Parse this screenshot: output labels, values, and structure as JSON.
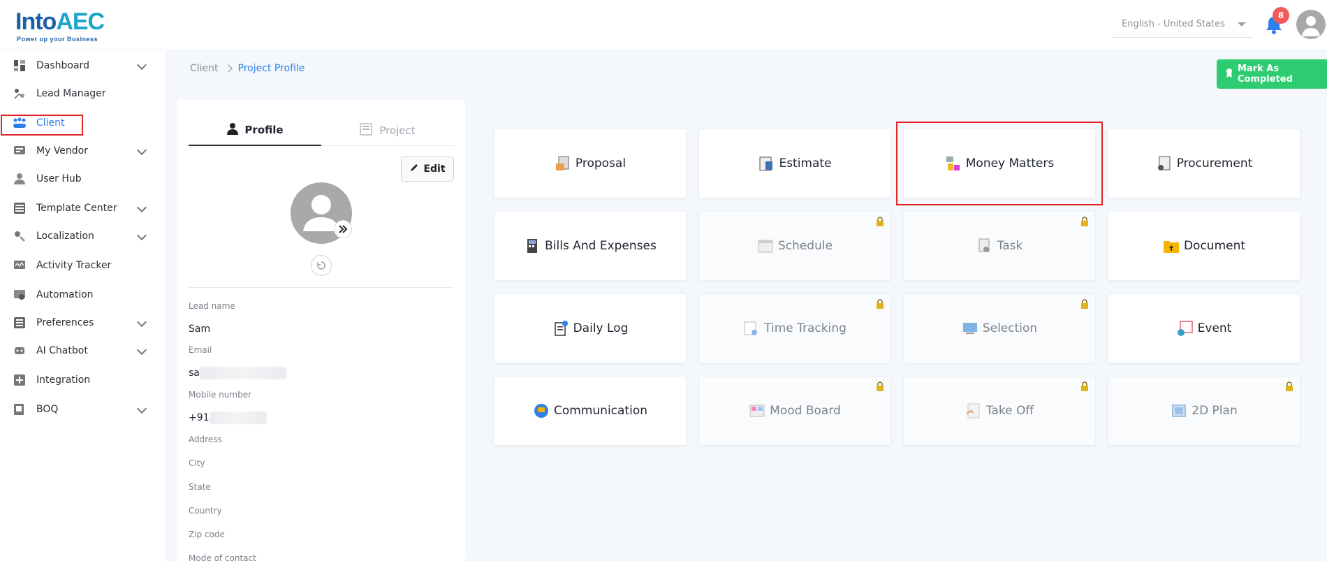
{
  "brand": {
    "logo_main": "Into",
    "logo_accent": "AEC",
    "tagline": "Power up your Business"
  },
  "header": {
    "language": "English - United States",
    "notification_count": "8"
  },
  "sidebar": {
    "items": [
      {
        "label": "Dashboard",
        "icon": "dashboard-icon",
        "has_chevron": true
      },
      {
        "label": "Lead Manager",
        "icon": "lead-manager-icon",
        "has_chevron": false
      },
      {
        "label": "Client",
        "icon": "client-icon",
        "has_chevron": false,
        "active": true
      },
      {
        "label": "My Vendor",
        "icon": "vendor-icon",
        "has_chevron": true
      },
      {
        "label": "User Hub",
        "icon": "user-icon",
        "has_chevron": false
      },
      {
        "label": "Template Center",
        "icon": "template-icon",
        "has_chevron": true
      },
      {
        "label": "Localization",
        "icon": "localization-icon",
        "has_chevron": true
      },
      {
        "label": "Activity Tracker",
        "icon": "activity-icon",
        "has_chevron": false
      },
      {
        "label": "Automation",
        "icon": "automation-icon",
        "has_chevron": false
      },
      {
        "label": "Preferences",
        "icon": "preferences-icon",
        "has_chevron": true
      },
      {
        "label": "AI Chatbot",
        "icon": "chatbot-icon",
        "has_chevron": true
      },
      {
        "label": "Integration",
        "icon": "integration-icon",
        "has_chevron": false
      },
      {
        "label": "BOQ",
        "icon": "boq-icon",
        "has_chevron": true
      }
    ]
  },
  "breadcrumb": {
    "parent": "Client",
    "current": "Project Profile"
  },
  "actions": {
    "mark_completed": "Mark As Completed"
  },
  "profile": {
    "tab_profile": "Profile",
    "tab_project": "Project",
    "edit_label": "Edit",
    "fields": [
      {
        "label": "Lead name",
        "value": "Sam"
      },
      {
        "label": "Email",
        "value": "sa"
      },
      {
        "label": "Mobile number",
        "value": "+91"
      },
      {
        "label": "Address",
        "value": ""
      },
      {
        "label": "City",
        "value": ""
      },
      {
        "label": "State",
        "value": ""
      },
      {
        "label": "Country",
        "value": ""
      },
      {
        "label": "Zip code",
        "value": ""
      },
      {
        "label": "Mode of contact",
        "value": ""
      }
    ]
  },
  "modules": [
    {
      "label": "Proposal",
      "icon": "proposal-icon",
      "locked": false
    },
    {
      "label": "Estimate",
      "icon": "estimate-icon",
      "locked": false
    },
    {
      "label": "Money Matters",
      "icon": "money-matters-icon",
      "locked": false,
      "highlighted": true
    },
    {
      "label": "Procurement",
      "icon": "procurement-icon",
      "locked": false
    },
    {
      "label": "Bills And Expenses",
      "icon": "bills-icon",
      "locked": false
    },
    {
      "label": "Schedule",
      "icon": "schedule-icon",
      "locked": true
    },
    {
      "label": "Task",
      "icon": "task-icon",
      "locked": true
    },
    {
      "label": "Document",
      "icon": "document-icon",
      "locked": false
    },
    {
      "label": "Daily Log",
      "icon": "daily-log-icon",
      "locked": false
    },
    {
      "label": "Time Tracking",
      "icon": "time-tracking-icon",
      "locked": true
    },
    {
      "label": "Selection",
      "icon": "selection-icon",
      "locked": true
    },
    {
      "label": "Event",
      "icon": "event-icon",
      "locked": false
    },
    {
      "label": "Communication",
      "icon": "communication-icon",
      "locked": false
    },
    {
      "label": "Mood Board",
      "icon": "mood-board-icon",
      "locked": true
    },
    {
      "label": "Take Off",
      "icon": "take-off-icon",
      "locked": true
    },
    {
      "label": "2D Plan",
      "icon": "2d-plan-icon",
      "locked": true
    }
  ],
  "colors": {
    "accent": "#2f80ed",
    "success": "#2ecc71",
    "highlight": "#e02424",
    "badge": "#f25a5a"
  }
}
